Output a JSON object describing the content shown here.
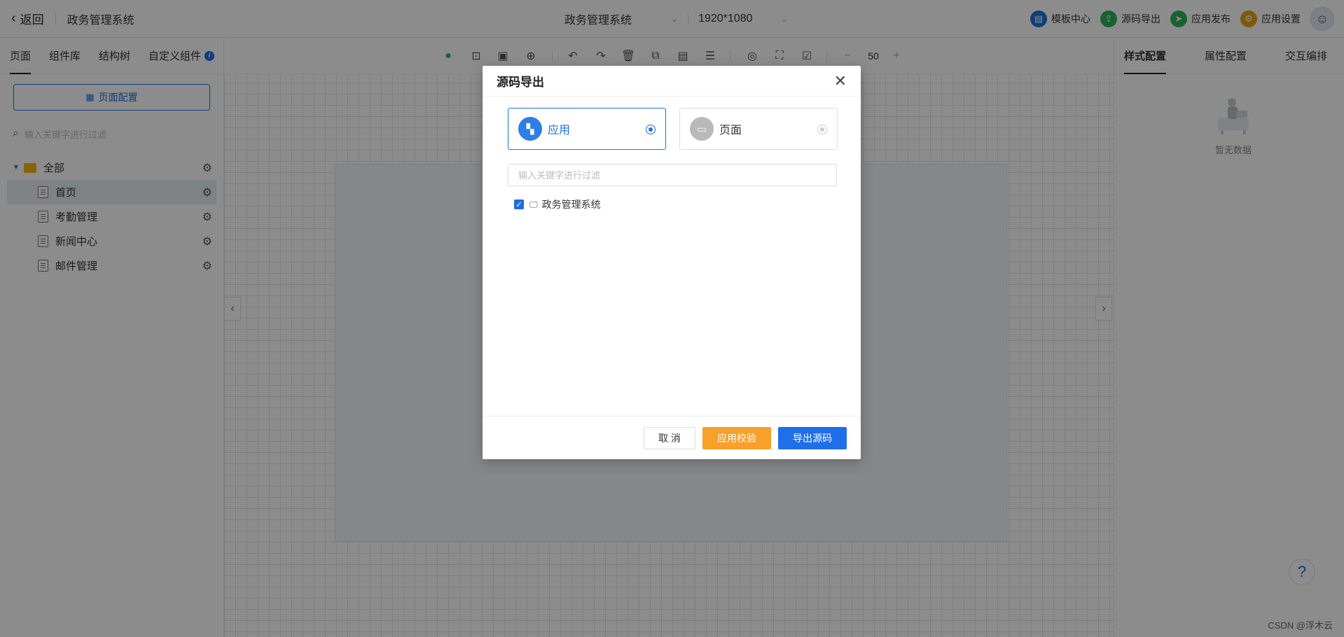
{
  "header": {
    "back_label": "返回",
    "system_name": "政务管理系统",
    "center_system": "政务管理系统",
    "resolution": "1920*1080",
    "actions": [
      {
        "label": "模板中心",
        "icon": "template-icon",
        "color": "#1f6fd9"
      },
      {
        "label": "源码导出",
        "icon": "export-icon",
        "color": "#2db35a"
      },
      {
        "label": "应用发布",
        "icon": "send-icon",
        "color": "#2db35a"
      },
      {
        "label": "应用设置",
        "icon": "settings-icon",
        "color": "#e6a316"
      }
    ]
  },
  "left": {
    "tabs": [
      "页面",
      "组件库",
      "结构树",
      "自定义组件"
    ],
    "page_config": "页面配置",
    "filter_placeholder": "输入关键字进行过滤",
    "tree": {
      "root": "全部",
      "items": [
        "首页",
        "考勤管理",
        "新闻中心",
        "邮件管理"
      ]
    }
  },
  "toolbar": {
    "zoom": "50"
  },
  "right": {
    "tabs": [
      "样式配置",
      "属性配置",
      "交互编排"
    ],
    "empty_text": "暂无数据"
  },
  "modal": {
    "title": "源码导出",
    "options": [
      {
        "label": "应用",
        "selected": true
      },
      {
        "label": "页面",
        "selected": false
      }
    ],
    "search_placeholder": "输入关键字进行过滤",
    "item_label": "政务管理系统",
    "buttons": {
      "cancel": "取 消",
      "check": "应用校验",
      "export": "导出源码"
    }
  },
  "watermark": "CSDN @浮木云",
  "colors": {
    "primary": "#1f6fd9",
    "orange": "#f7a02a"
  }
}
